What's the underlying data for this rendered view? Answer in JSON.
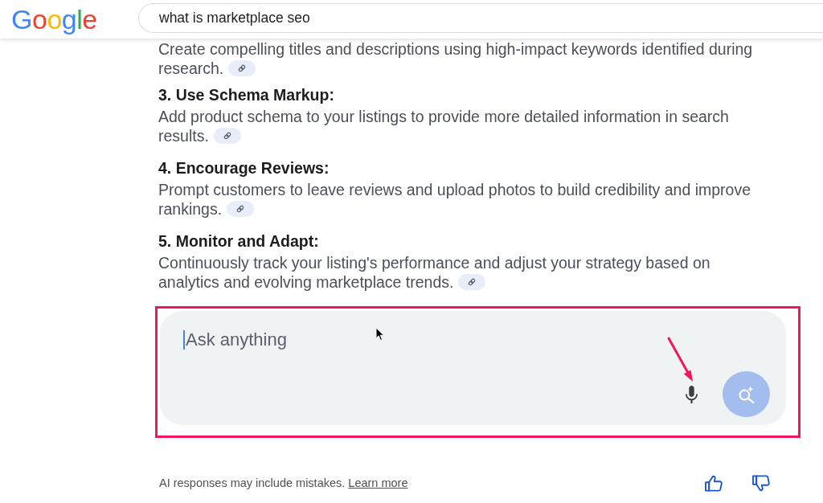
{
  "header": {
    "logo": "Google",
    "search": {
      "value": "what is marketplace seo"
    }
  },
  "answer": {
    "continued_text": "Create compelling titles and descriptions using high-impact keywords identified during research.",
    "steps": [
      {
        "title": "3. Use Schema Markup:",
        "text": "Add product schema to your listings to provide more detailed information in search results."
      },
      {
        "title": "4. Encourage Reviews:",
        "text": "Prompt customers to leave reviews and upload photos to build credibility and improve rankings."
      },
      {
        "title": "5. Monitor and Adapt:",
        "text": "Continuously track your listing's performance and adjust your strategy based on analytics and evolving marketplace trends."
      }
    ]
  },
  "ask": {
    "placeholder": "Ask anything",
    "annotations": {
      "highlight_frame": true,
      "arrow_to_microphone": true
    }
  },
  "footer": {
    "disclaimer": "AI responses may include mistakes.",
    "link": "Learn more"
  }
}
